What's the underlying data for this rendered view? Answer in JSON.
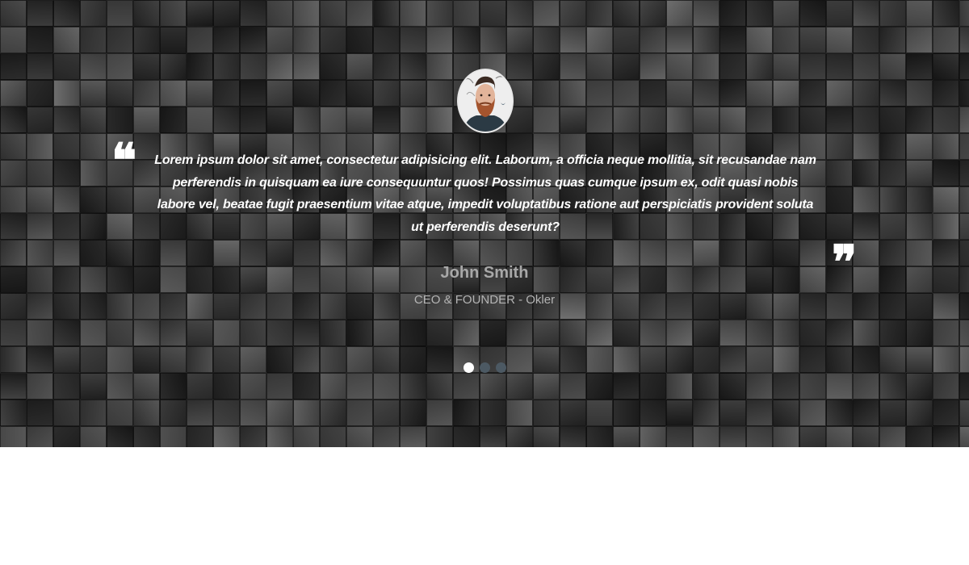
{
  "testimonial": {
    "open_quote": "❝",
    "close_quote": "❞",
    "text": "Lorem ipsum dolor sit amet, consectetur adipisicing elit. Laborum, a officia neque mollitia, sit recusandae nam perferendis in quisquam ea iure consequuntur quos! Possimus quas cumque ipsum ex, odit quasi nobis labore vel, beatae fugit praesentium vitae atque, impedit voluptatibus ratione aut perspiciatis provident soluta ut perferendis deserunt?",
    "author_name": "John Smith",
    "author_role": "CEO & FOUNDER - Okler",
    "avatar_icon": "bearded-man-avatar"
  },
  "carousel": {
    "slide_count": 3,
    "active_index": 0,
    "active_color": "#ffffff",
    "inactive_color": "#4c5963"
  },
  "background": {
    "style": "grayscale photo mosaic",
    "base_color": "#1c1c1c"
  }
}
